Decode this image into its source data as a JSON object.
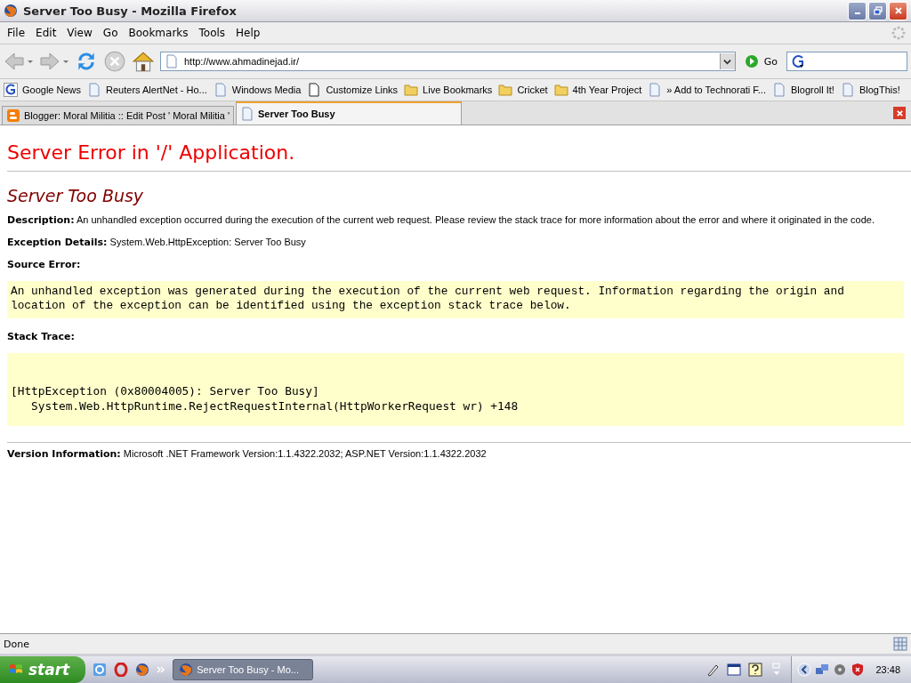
{
  "window": {
    "title": "Server Too Busy - Mozilla Firefox"
  },
  "menu": [
    "File",
    "Edit",
    "View",
    "Go",
    "Bookmarks",
    "Tools",
    "Help"
  ],
  "navigation": {
    "url": "http://www.ahmadinejad.ir/",
    "go_label": "Go"
  },
  "bookmarks": [
    {
      "label": "Google News",
      "kind": "google"
    },
    {
      "label": "Reuters AlertNet - Ho...",
      "kind": "page"
    },
    {
      "label": "Windows Media",
      "kind": "page"
    },
    {
      "label": "Customize Links",
      "kind": "blank"
    },
    {
      "label": "Live Bookmarks",
      "kind": "folder"
    },
    {
      "label": "Cricket",
      "kind": "folder"
    },
    {
      "label": "4th Year Project",
      "kind": "folder"
    },
    {
      "label": "» Add to Technorati F...",
      "kind": "page"
    },
    {
      "label": "Blogroll It!",
      "kind": "page"
    },
    {
      "label": "BlogThis!",
      "kind": "page"
    }
  ],
  "tabs": [
    {
      "label": "Blogger: Moral Militia :: Edit Post ' Moral Militia '",
      "kind": "blogger",
      "selected": false
    },
    {
      "label": "Server Too Busy",
      "kind": "page",
      "selected": true
    }
  ],
  "page": {
    "heading": "Server Error in '/' Application.",
    "subheading": "Server Too Busy",
    "description": {
      "label": "Description:",
      "text": "An unhandled exception occurred during the execution of the current web request. Please review the stack trace for more information about the error and where it originated in the code."
    },
    "exception_details": {
      "label": "Exception Details:",
      "text": "System.Web.HttpException: Server Too Busy"
    },
    "source_error": {
      "label": "Source Error:",
      "lines": [
        "An unhandled exception was generated during the execution of the current web request. Information regarding the origin and",
        "location of the exception can be identified using the exception stack trace below."
      ]
    },
    "stack_trace": {
      "label": "Stack Trace:",
      "lines": [
        "[HttpException (0x80004005): Server Too Busy]",
        "   System.Web.HttpRuntime.RejectRequestInternal(HttpWorkerRequest wr) +148"
      ]
    },
    "version": {
      "label": "Version Information:",
      "text": "Microsoft .NET Framework Version:1.1.4322.2032; ASP.NET Version:1.1.4322.2032"
    }
  },
  "status_bar": {
    "text": "Done"
  },
  "taskbar": {
    "start": "start",
    "task": "Server Too Busy - Mo...",
    "clock": "23:48"
  }
}
